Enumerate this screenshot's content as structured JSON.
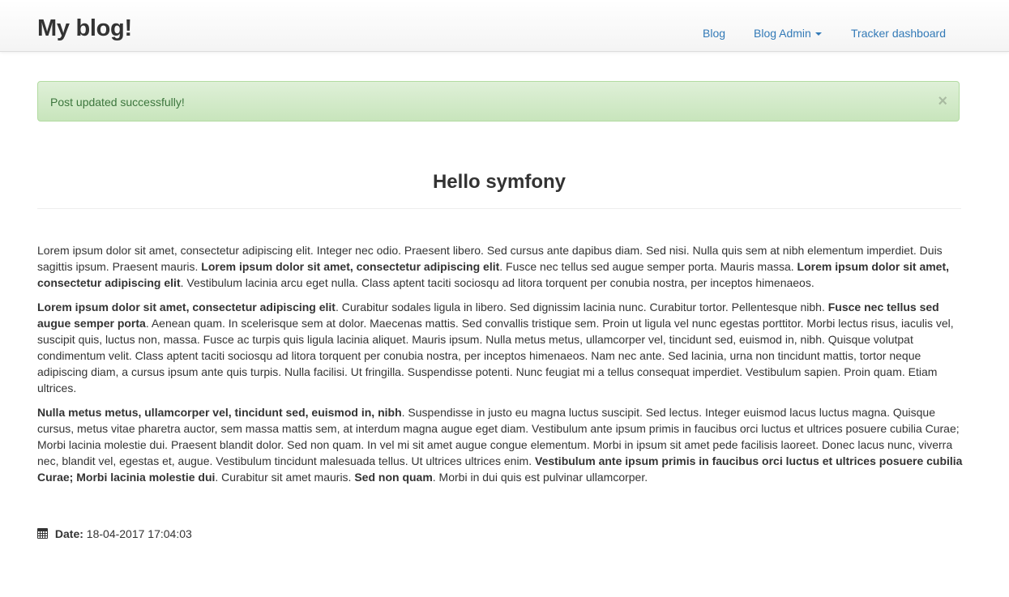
{
  "brand": "My blog!",
  "nav": {
    "blog": "Blog",
    "blog_admin": "Blog Admin",
    "tracker_dashboard": "Tracker dashboard"
  },
  "alert": {
    "message": "Post updated successfully!",
    "close": "×"
  },
  "post": {
    "title": "Hello symfony",
    "paragraphs": [
      [
        {
          "text": "Lorem ipsum dolor sit amet, consectetur adipiscing elit. Integer nec odio. Praesent libero. Sed cursus ante dapibus diam. Sed nisi. Nulla quis sem at nibh elementum imperdiet. Duis sagittis ipsum. Praesent mauris. ",
          "bold": false
        },
        {
          "text": "Lorem ipsum dolor sit amet, consectetur adipiscing elit",
          "bold": true
        },
        {
          "text": ". Fusce nec tellus sed augue semper porta. Mauris massa. ",
          "bold": false
        },
        {
          "text": "Lorem ipsum dolor sit amet, consectetur adipiscing elit",
          "bold": true
        },
        {
          "text": ". Vestibulum lacinia arcu eget nulla. Class aptent taciti sociosqu ad litora torquent per conubia nostra, per inceptos himenaeos.",
          "bold": false
        }
      ],
      [
        {
          "text": "Lorem ipsum dolor sit amet, consectetur adipiscing elit",
          "bold": true
        },
        {
          "text": ". Curabitur sodales ligula in libero. Sed dignissim lacinia nunc. Curabitur tortor. Pellentesque nibh. ",
          "bold": false
        },
        {
          "text": "Fusce nec tellus sed augue semper porta",
          "bold": true
        },
        {
          "text": ". Aenean quam. In scelerisque sem at dolor. Maecenas mattis. Sed convallis tristique sem. Proin ut ligula vel nunc egestas porttitor. Morbi lectus risus, iaculis vel, suscipit quis, luctus non, massa. Fusce ac turpis quis ligula lacinia aliquet. Mauris ipsum. Nulla metus metus, ullamcorper vel, tincidunt sed, euismod in, nibh. Quisque volutpat condimentum velit. Class aptent taciti sociosqu ad litora torquent per conubia nostra, per inceptos himenaeos. Nam nec ante. Sed lacinia, urna non tincidunt mattis, tortor neque adipiscing diam, a cursus ipsum ante quis turpis. Nulla facilisi. Ut fringilla. Suspendisse potenti. Nunc feugiat mi a tellus consequat imperdiet. Vestibulum sapien. Proin quam. Etiam ultrices.",
          "bold": false
        }
      ],
      [
        {
          "text": "Nulla metus metus, ullamcorper vel, tincidunt sed, euismod in, nibh",
          "bold": true
        },
        {
          "text": ". Suspendisse in justo eu magna luctus suscipit. Sed lectus. Integer euismod lacus luctus magna. Quisque cursus, metus vitae pharetra auctor, sem massa mattis sem, at interdum magna augue eget diam. Vestibulum ante ipsum primis in faucibus orci luctus et ultrices posuere cubilia Curae; Morbi lacinia molestie dui. Praesent blandit dolor. Sed non quam. In vel mi sit amet augue congue elementum. Morbi in ipsum sit amet pede facilisis laoreet. Donec lacus nunc, viverra nec, blandit vel, egestas et, augue. Vestibulum tincidunt malesuada tellus. Ut ultrices ultrices enim. ",
          "bold": false
        },
        {
          "text": "Vestibulum ante ipsum primis in faucibus orci luctus et ultrices posuere cubilia Curae; Morbi lacinia molestie dui",
          "bold": true
        },
        {
          "text": ". Curabitur sit amet mauris. ",
          "bold": false
        },
        {
          "text": "Sed non quam",
          "bold": true
        },
        {
          "text": ". Morbi in dui quis est pulvinar ullamcorper.",
          "bold": false
        }
      ]
    ],
    "date_label": "Date:",
    "date_value": "18-04-2017 17:04:03",
    "date_icon": "calendar-icon"
  },
  "colors": {
    "link": "#337ab7",
    "alert_text": "#3c763d",
    "alert_bg": "#dff0d8",
    "text": "#333333"
  }
}
